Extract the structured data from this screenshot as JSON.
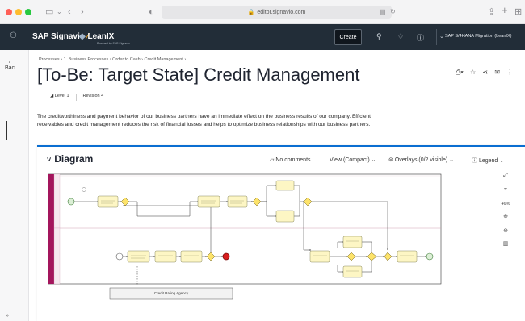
{
  "browser": {
    "url": "editor.signavio.com",
    "colors": {
      "close": "#ff5f57",
      "minimize": "#febc2e",
      "maximize": "#28c840"
    }
  },
  "header": {
    "brand_signavio": "SAP Signavio",
    "brand_leanix": "LeanIX",
    "leanix_tagline": "Powered by SAP Signavio",
    "create_label": "Create",
    "workspace": "SAP S/4HANA Migration (LeanIX)"
  },
  "rail": {
    "back_label": "Bac",
    "expand_label": "»"
  },
  "breadcrumb": "Processes  ›  1. Business Processes  ›  Order to Cash  ›  Credit Management  ›",
  "title": "[To-Be: Target State] Credit Management",
  "meta": {
    "level": "Level 1",
    "revision": "Revision 4"
  },
  "description": "The creditworthiness and payment behavior of our business partners have an immediate effect on the business results of our company. Efficient receivables and credit management reduces the risk of financial losses and helps to optimize business relationships with our business partners.",
  "diagram": {
    "title": "Diagram",
    "comments": "No comments",
    "view": "View (Compact)",
    "overlays": "Overlays (0/2 visible)",
    "legend": "Legend",
    "zoom_level": "46%",
    "external_participant": "Credit Rating Agency"
  }
}
